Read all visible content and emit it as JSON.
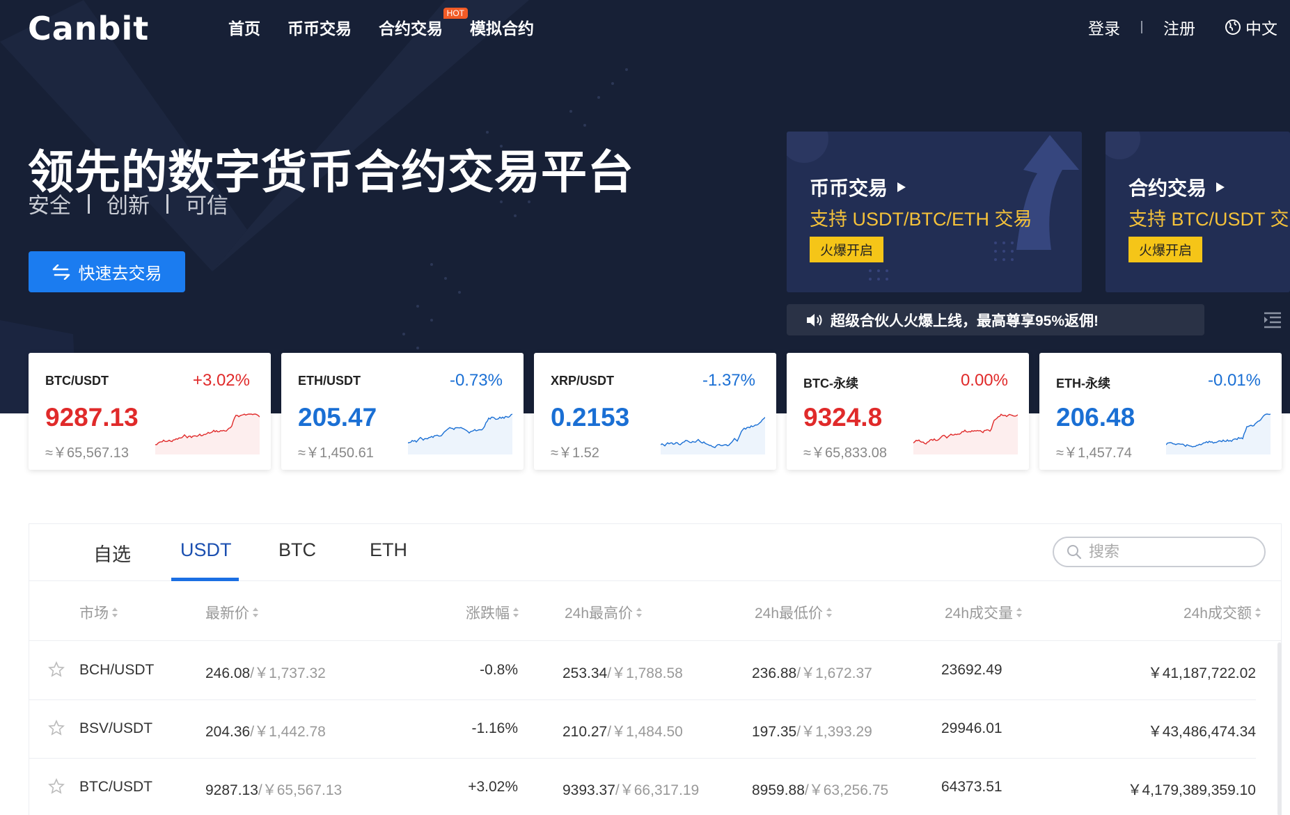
{
  "nav": {
    "logo": "Canbit",
    "menu": [
      "首页",
      "币币交易",
      "合约交易",
      "模拟合约"
    ],
    "hot_badge": "HOT",
    "login": "登录",
    "register": "注册",
    "language": "中文"
  },
  "hero": {
    "title": "领先的数字货币合约交易平台",
    "subtitle": [
      "安全",
      "创新",
      "可信"
    ],
    "cta": "快速去交易"
  },
  "promos": [
    {
      "title": "币币交易",
      "desc": "支持 USDT/BTC/ETH 交易",
      "tag": "火爆开启"
    },
    {
      "title": "合约交易",
      "desc": "支持 BTC/USDT 交",
      "tag": "火爆开启"
    }
  ],
  "notice": "超级合伙人火爆上线，最高尊享95%返佣!",
  "tickers": [
    {
      "pair": "BTC/USDT",
      "change": "+3.02%",
      "price": "9287.13",
      "cny": "≈￥65,567.13",
      "trend": "up",
      "color": "#e02a2a"
    },
    {
      "pair": "ETH/USDT",
      "change": "-0.73%",
      "price": "205.47",
      "cny": "≈￥1,450.61",
      "trend": "down",
      "color": "#1a6fd4"
    },
    {
      "pair": "XRP/USDT",
      "change": "-1.37%",
      "price": "0.2153",
      "cny": "≈￥1.52",
      "trend": "down",
      "color": "#1a6fd4"
    },
    {
      "pair": "BTC-永续",
      "change": "0.00%",
      "price": "9324.8",
      "cny": "≈￥65,833.08",
      "trend": "up",
      "color": "#e02a2a"
    },
    {
      "pair": "ETH-永续",
      "change": "-0.01%",
      "price": "206.48",
      "cny": "≈￥1,457.74",
      "trend": "down",
      "color": "#1a6fd4"
    }
  ],
  "market": {
    "tabs": [
      "自选",
      "USDT",
      "BTC",
      "ETH"
    ],
    "active_tab": "USDT",
    "search_placeholder": "搜索",
    "columns": [
      "市场",
      "最新价",
      "涨跌幅",
      "24h最高价",
      "24h最低价",
      "24h成交量",
      "24h成交额"
    ],
    "rows": [
      {
        "pair": "BCH/USDT",
        "last": "246.08",
        "last_cny": "/￥1,737.32",
        "change": "-0.8%",
        "high": "253.34",
        "high_cny": "/￥1,788.58",
        "low": "236.88",
        "low_cny": "/￥1,672.37",
        "volume": "23692.49",
        "amount": "￥41,187,722.02",
        "trend": "down"
      },
      {
        "pair": "BSV/USDT",
        "last": "204.36",
        "last_cny": "/￥1,442.78",
        "change": "-1.16%",
        "high": "210.27",
        "high_cny": "/￥1,484.50",
        "low": "197.35",
        "low_cny": "/￥1,393.29",
        "volume": "29946.01",
        "amount": "￥43,486,474.34",
        "trend": "down"
      },
      {
        "pair": "BTC/USDT",
        "last": "9287.13",
        "last_cny": "/￥65,567.13",
        "change": "+3.02%",
        "high": "9393.37",
        "high_cny": "/￥66,317.19",
        "low": "8959.88",
        "low_cny": "/￥63,256.75",
        "volume": "64373.51",
        "amount": "￥4,179,389,359.10",
        "trend": "up"
      }
    ]
  },
  "colors": {
    "hero_bg": "#172036",
    "accent_blue": "#1b7cf0",
    "up_red": "#e02a2a",
    "down_blue": "#1a6fd4",
    "promo_yellow": "#f5c23a"
  }
}
